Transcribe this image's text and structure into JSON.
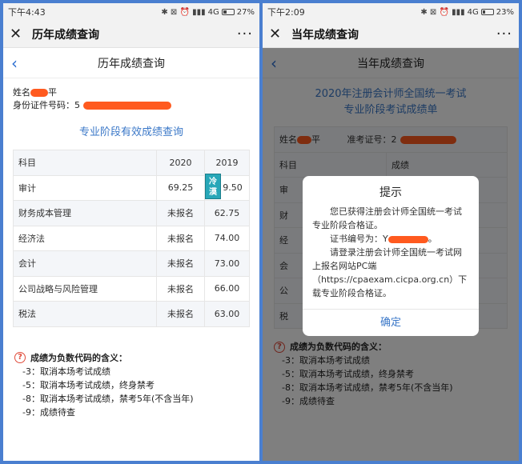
{
  "left": {
    "status": {
      "time": "下午4:43",
      "network": "4G",
      "battery": "27%",
      "icons": "✱ ⊠ ⏰ ▮▮▮"
    },
    "window_title": "历年成绩查询",
    "nav_title": "历年成绩查询",
    "name_label": "姓名",
    "name_visible": "平",
    "id_label": "身份证件号码：",
    "id_visible": "5",
    "section_title": "专业阶段有效成绩查询",
    "table": {
      "headers": [
        "科目",
        "2020",
        "2019"
      ],
      "rows": [
        {
          "subject": "审计",
          "y2020": "69.25",
          "y2019": "9.50"
        },
        {
          "subject": "财务成本管理",
          "y2020": "未报名",
          "y2019": "62.75"
        },
        {
          "subject": "经济法",
          "y2020": "未报名",
          "y2019": "74.00"
        },
        {
          "subject": "会计",
          "y2020": "未报名",
          "y2019": "73.00"
        },
        {
          "subject": "公司战略与风险管理",
          "y2020": "未报名",
          "y2019": "66.00"
        },
        {
          "subject": "税法",
          "y2020": "未报名",
          "y2019": "63.00"
        }
      ]
    },
    "badge": "冷漠",
    "notes": {
      "heading": "成绩为负数代码的含义：",
      "lines": [
        "-3：取消本场考试成绩",
        "-5：取消本场考试成绩，终身禁考",
        "-8：取消本场考试成绩，禁考5年(不含当年)",
        "-9：成绩待查"
      ]
    }
  },
  "right": {
    "status": {
      "time": "下午2:09",
      "network": "4G",
      "battery": "23%",
      "icons": "✱ ⊠ ⏰ ▮▮▮"
    },
    "window_title": "当年成绩查询",
    "nav_title": "当年成绩查询",
    "cert_title_1": "2020年注册会计师全国统一考试",
    "cert_title_2": "专业阶段考试成绩单",
    "name_label": "姓名",
    "name_visible": "平",
    "exam_no_label": "准考证号：",
    "exam_no_visible": "2",
    "table_headers": [
      "科目",
      "成绩"
    ],
    "row_prefixes": [
      "审",
      "财",
      "经",
      "会",
      "公",
      "税"
    ],
    "dialog": {
      "title": "提示",
      "p1": "您已获得注册会计师全国统一考试专业阶段合格证。",
      "p2": "证书编号为：Y",
      "p3": "请登录注册会计师全国统一考试网上报名网站PC端（https://cpaexam.cicpa.org.cn）下载专业阶段合格证。",
      "confirm": "确定"
    },
    "notes": {
      "heading": "成绩为负数代码的含义：",
      "lines": [
        "-3：取消本场考试成绩",
        "-5：取消本场考试成绩，终身禁考",
        "-8：取消本场考试成绩，禁考5年(不含当年)",
        "-9：成绩待查"
      ]
    }
  }
}
